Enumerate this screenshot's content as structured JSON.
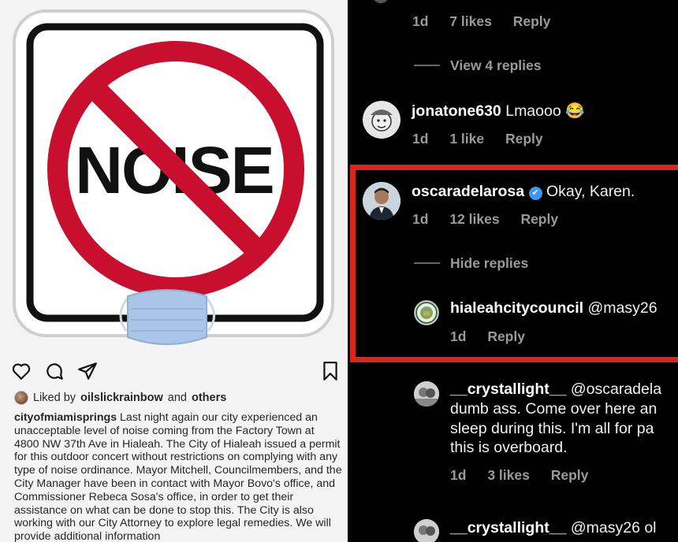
{
  "post": {
    "sign_text": "NOISE",
    "liked_by_prefix": "Liked by",
    "liked_by_user": "oilslickrainbow",
    "liked_by_and": "and",
    "liked_by_others": "others",
    "caption_user": "cityofmiamisprings",
    "caption_text": "Last night again our city experienced an unacceptable level of noise coming from the Factory Town at 4800 NW 37th Ave in Hialeah. The City of Hialeah issued a permit for this outdoor concert without restrictions on complying with any type of noise ordinance. Mayor Mitchell, Councilmembers, and the City Manager have been in contact with Mayor Bovo's office, and Commissioner Rebeca Sosa's office, in order to get their assistance on what can be done to stop this. The City is also working with our City Attorney to explore legal remedies. We will provide additional information"
  },
  "comments": {
    "top": {
      "age": "1d",
      "likes": "7 likes",
      "reply": "Reply"
    },
    "view_replies": "View 4 replies",
    "jonatone": {
      "user": "jonatone630",
      "text": "Lmaooo 😂",
      "age": "1d",
      "likes": "1 like",
      "reply": "Reply"
    },
    "oscar": {
      "user": "oscaradelarosa",
      "verified": "✔",
      "text": "Okay, Karen.",
      "age": "1d",
      "likes": "12 likes",
      "reply": "Reply"
    },
    "hide_replies": "Hide replies",
    "hialeah": {
      "user": "hialeahcitycouncil",
      "text": "@masy26",
      "age": "1d",
      "reply": "Reply"
    },
    "crystal1": {
      "user": "__crystallight__",
      "mention": "@oscaradela",
      "line2": "dumb ass. Come over here an",
      "line3": "sleep during this. I'm all for pa",
      "line4": "this is overboard.",
      "age": "1d",
      "likes": "3 likes",
      "reply": "Reply"
    },
    "crystal2": {
      "user": "__crystallight__",
      "mention": "@masy26 ol"
    }
  },
  "colors": {
    "highlight": "#d9261c",
    "verified": "#3897f0",
    "dark_bg": "#000000",
    "light_bg": "#f4f4f4"
  },
  "icons": [
    "heart-icon",
    "comment-icon",
    "share-icon",
    "bookmark-icon",
    "verified-badge-icon"
  ]
}
